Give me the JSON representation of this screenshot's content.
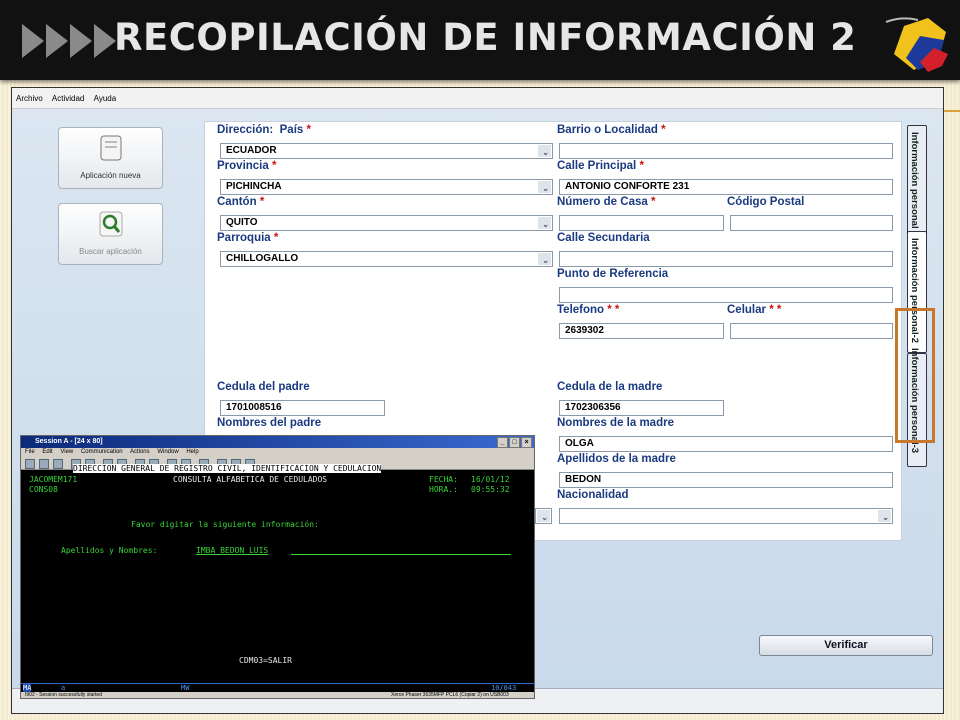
{
  "banner": {
    "title": "RECOPILACIÓN DE INFORMACIÓN 2"
  },
  "menu": [
    "Archivo",
    "Actividad",
    "Ayuda"
  ],
  "sidebar": {
    "new_app": "Aplicación nueva",
    "search_app": "Buscar aplicación"
  },
  "form": {
    "direccion_label": "Dirección:",
    "pais_label": "País",
    "pais_value": "ECUADOR",
    "provincia_label": "Provincia",
    "provincia_value": "PICHINCHA",
    "canton_label": "Cantón",
    "canton_value": "QUITO",
    "parroquia_label": "Parroquia",
    "parroquia_value": "CHILLOGALLO",
    "barrio_label": "Barrio o Localidad",
    "barrio_value": "",
    "calle_principal_label": "Calle Principal",
    "calle_principal_value": "ANTONIO CONFORTE 231",
    "numero_casa_label": "Número de Casa",
    "numero_casa_value": "",
    "codigo_postal_label": "Código Postal",
    "codigo_postal_value": "",
    "calle_secundaria_label": "Calle Secundaria",
    "calle_secundaria_value": "",
    "referencia_label": "Punto de Referencia",
    "referencia_value": "",
    "telefono_label": "Telefono",
    "telefono_value": "2639302",
    "celular_label": "Celular",
    "celular_value": "",
    "cedula_padre_label": "Cedula del padre",
    "cedula_padre_value": "1701008516",
    "nombres_padre_label": "Nombres del padre",
    "cedula_madre_label": "Cedula de la madre",
    "cedula_madre_value": "1702306356",
    "nombres_madre_label": "Nombres de la madre",
    "nombres_madre_value": "OLGA",
    "apellidos_madre_label": "Apellidos de la madre",
    "apellidos_madre_value": "BEDON",
    "nacionalidad_label": "Nacionalidad",
    "nacionalidad_value": "",
    "required_mark": "*",
    "double_required_mark": "* *"
  },
  "tabs": [
    "Información personal",
    "Información personal-2",
    "Información personal-3"
  ],
  "verify_button": "Verificar",
  "emulator": {
    "title": "Session A - [24 x 80]",
    "menu": [
      "File",
      "Edit",
      "View",
      "Communication",
      "Actions",
      "Window",
      "Help"
    ],
    "header": "DIRECCION GENERAL DE REGISTRO CIVIL, IDENTIFICACION Y CEDULACION",
    "user": "JACOMEM171",
    "screen_title": "CONSULTA ALFABETICA DE CEDULADOS",
    "fecha_label": "FECHA:",
    "fecha_value": "16/01/12",
    "code": "CONS08",
    "hora_label": "HORA.:",
    "hora_value": "09:55:32",
    "prompt": "Favor digitar la siguiente información:",
    "field_label": "Apellidos y Nombres:",
    "field_value": "IMBA BEDON LUIS",
    "footer_cmd": "CDM03=SALIR",
    "status_ma": "MA",
    "status_a": "a",
    "status_mw": "MW",
    "status_pos": "10/043",
    "bottom_msg": "I902 - Session successfully started",
    "printer": "Xerox Phaser 3635MFP PCL6 (Copiar 2) on USB003"
  },
  "colors": {
    "label": "#1a3a80",
    "required": "#cc1111",
    "terminal_green": "#37d437",
    "highlight": "#c9772c"
  }
}
